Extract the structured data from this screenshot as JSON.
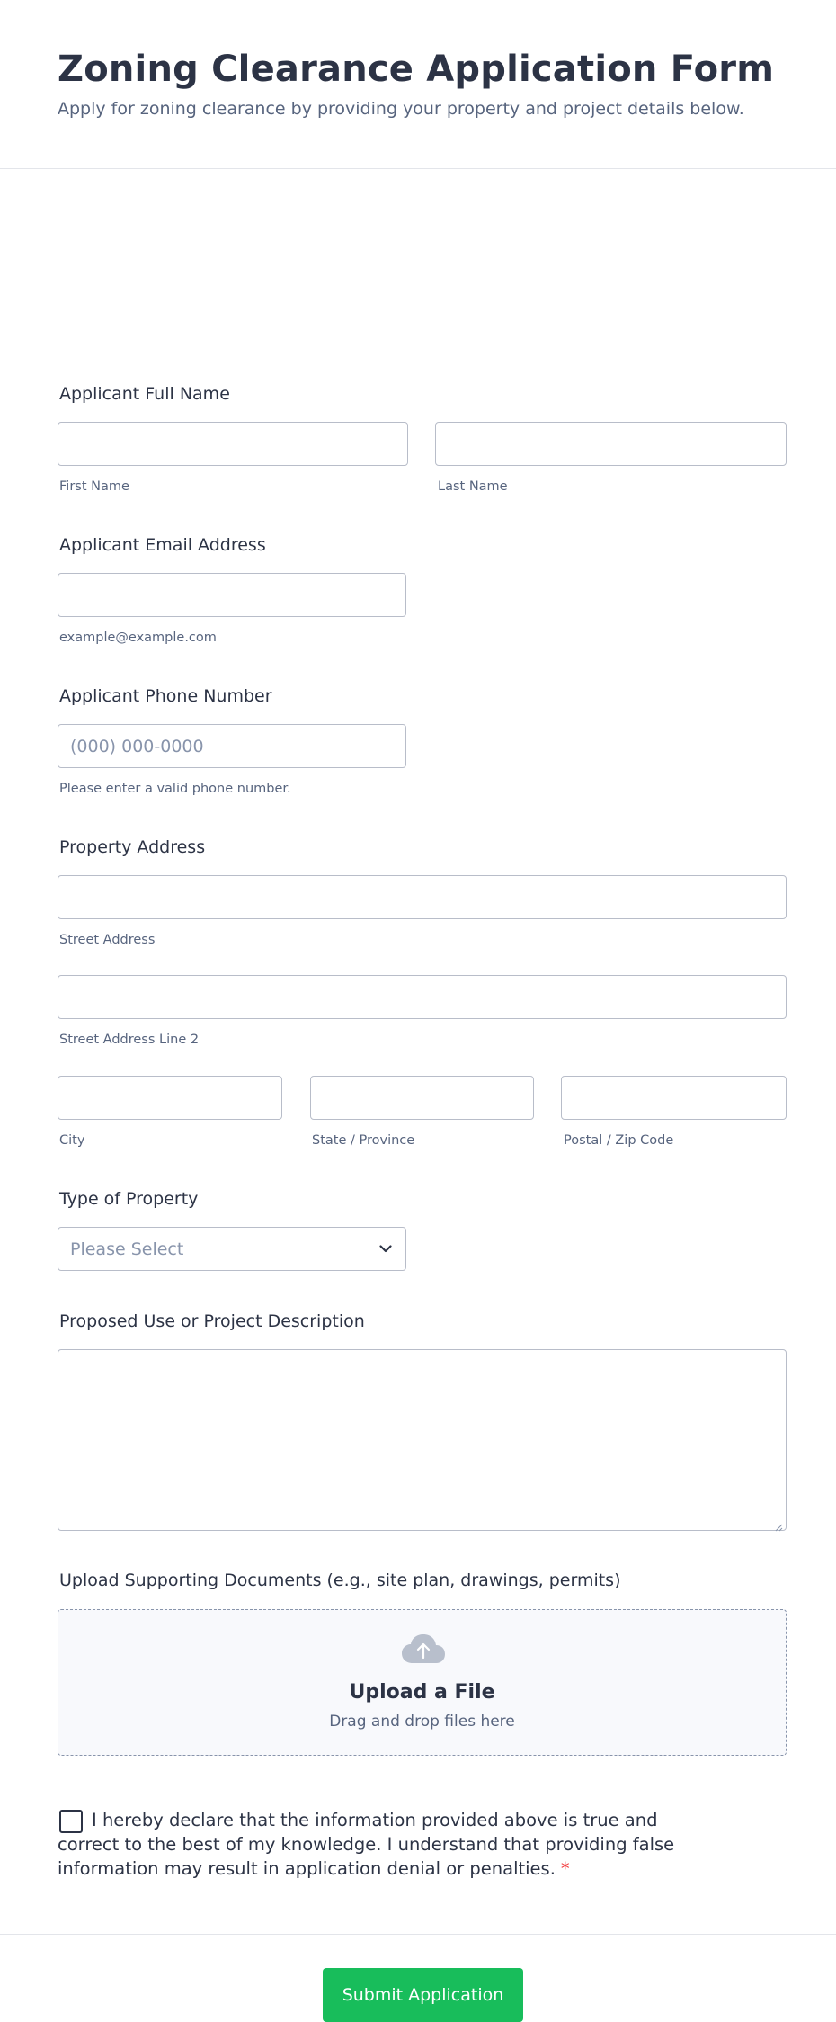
{
  "header": {
    "title": "Zoning Clearance Application Form",
    "subtitle": "Apply for zoning clearance by providing your property and project details below."
  },
  "name_field": {
    "label": "Applicant Full Name",
    "first_sublabel": "First Name",
    "last_sublabel": "Last Name",
    "first_value": "",
    "last_value": ""
  },
  "email_field": {
    "label": "Applicant Email Address",
    "value": "",
    "sublabel": "example@example.com"
  },
  "phone_field": {
    "label": "Applicant Phone Number",
    "placeholder": "(000) 000-0000",
    "sublabel": "Please enter a valid phone number."
  },
  "address_field": {
    "label": "Property Address",
    "street_sublabel": "Street Address",
    "street2_sublabel": "Street Address Line 2",
    "city_sublabel": "City",
    "state_sublabel": "State / Province",
    "zip_sublabel": "Postal / Zip Code"
  },
  "property_type": {
    "label": "Type of Property",
    "selected": "Please Select"
  },
  "description": {
    "label": "Proposed Use or Project Description",
    "value": ""
  },
  "upload": {
    "label": "Upload Supporting Documents (e.g., site plan, drawings, permits)",
    "title": "Upload a File",
    "subtitle": "Drag and drop files here"
  },
  "declaration": {
    "text": "I hereby declare that the information provided above is true and correct to the best of my knowledge. I understand that providing false information may result in application denial or penalties.",
    "required_mark": "*",
    "checked": false
  },
  "submit": {
    "label": "Submit Application",
    "color": "#18bd5b"
  }
}
